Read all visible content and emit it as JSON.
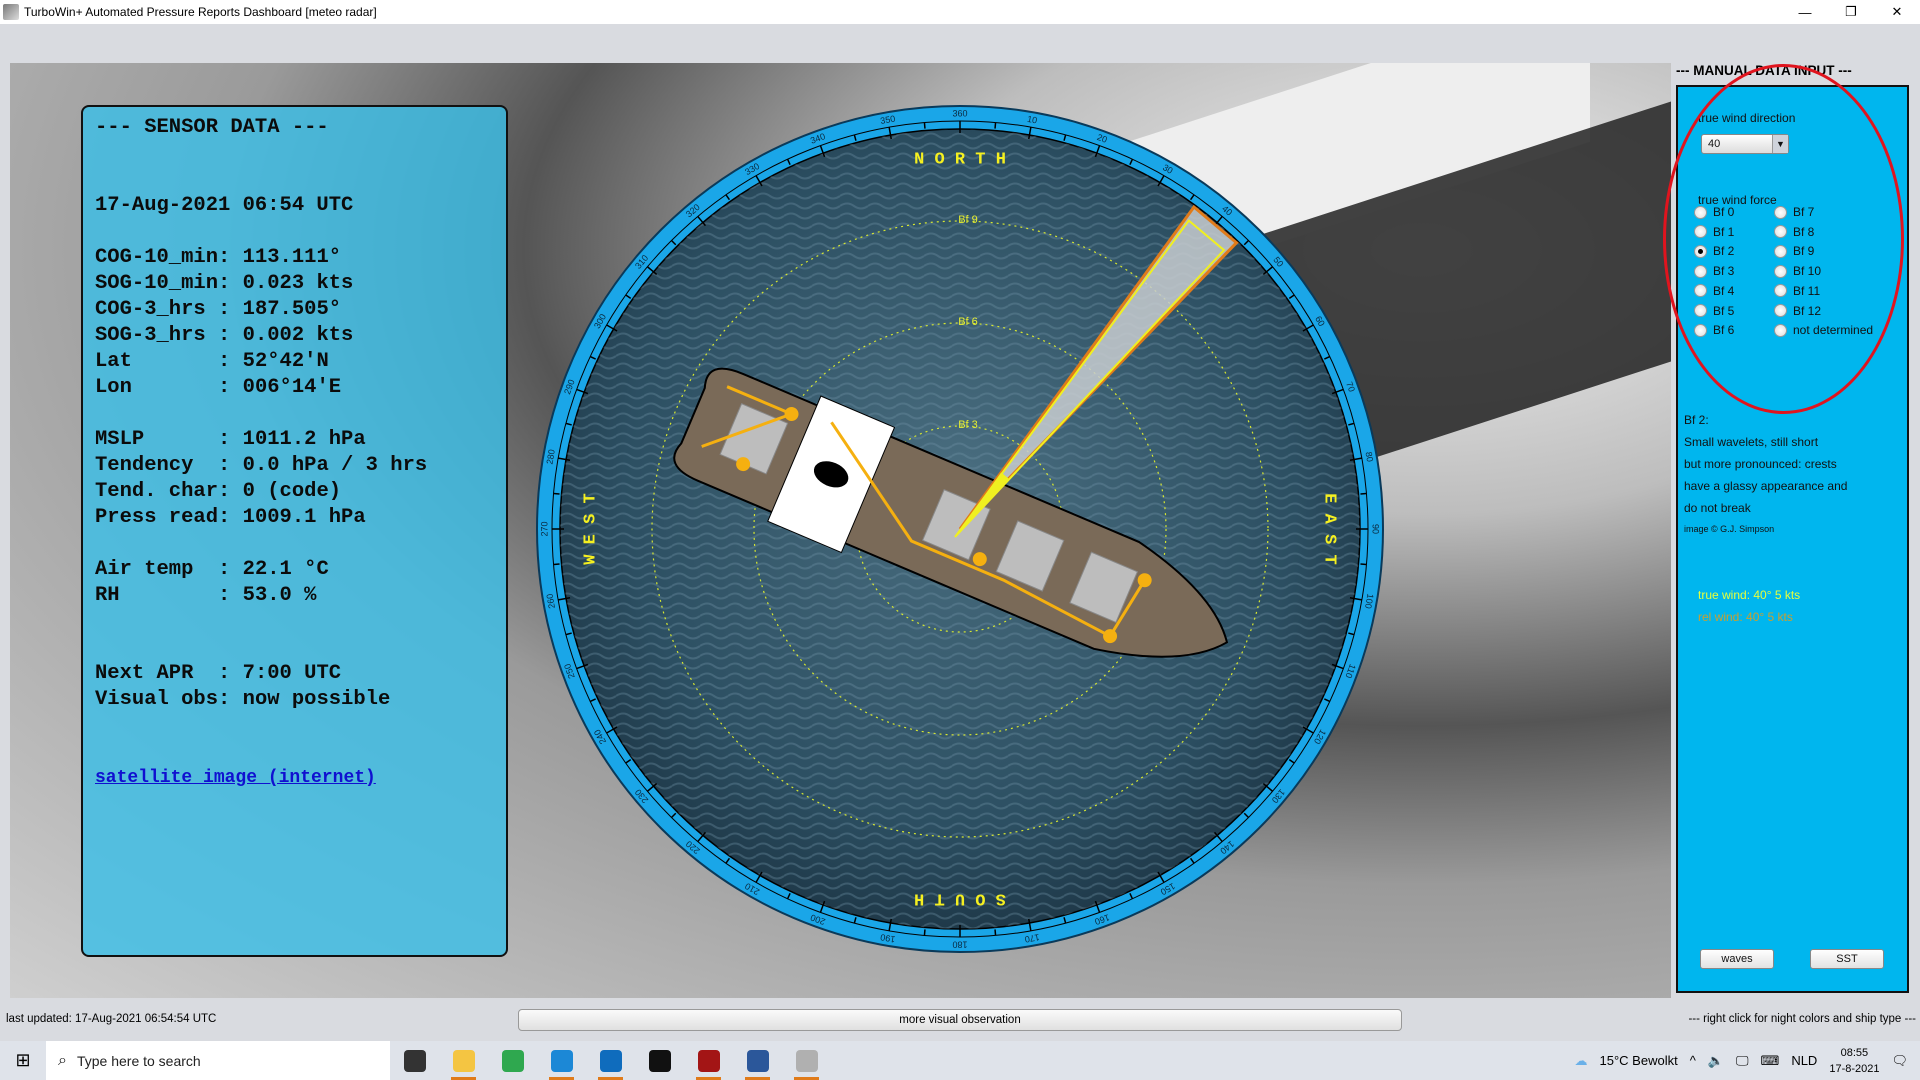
{
  "window": {
    "title": "TurboWin+ Automated Pressure Reports Dashboard [meteo radar]",
    "controls": [
      "—",
      "❐",
      "✕"
    ]
  },
  "sensor": {
    "title": "--- SENSOR DATA ---",
    "datetime": "17-Aug-2021 06:54 UTC",
    "groups": [
      [
        {
          "label": "COG-10_min",
          "value": "113.111°"
        },
        {
          "label": "SOG-10_min",
          "value": "0.023 kts"
        },
        {
          "label": "COG-3_hrs ",
          "value": "187.505°"
        },
        {
          "label": "SOG-3_hrs ",
          "value": "0.002 kts"
        },
        {
          "label": "Lat       ",
          "value": "52°42'N"
        },
        {
          "label": "Lon       ",
          "value": "006°14'E"
        }
      ],
      [
        {
          "label": "MSLP      ",
          "value": "1011.2 hPa"
        },
        {
          "label": "Tendency  ",
          "value": "0.0 hPa / 3 hrs"
        },
        {
          "label": "Tend. char",
          "value": "0 (code)"
        },
        {
          "label": "Press read",
          "value": "1009.1 hPa"
        }
      ],
      [
        {
          "label": "Air temp  ",
          "value": "22.1 °C"
        },
        {
          "label": "RH        ",
          "value": "53.0 %"
        }
      ],
      [
        {
          "label": "Next APR  ",
          "value": "7:00 UTC"
        },
        {
          "label": "Visual obs",
          "value": "now possible"
        }
      ]
    ],
    "link": "satellite image (internet)"
  },
  "compass": {
    "north": "N O R T H",
    "south": "S O U T H",
    "east": "E A S T",
    "west": "W E S T",
    "tick_labels": [
      "360",
      "10",
      "20",
      "30",
      "40",
      "50",
      "60",
      "70",
      "80",
      "90",
      "100",
      "110",
      "120",
      "130",
      "140",
      "150",
      "160",
      "170",
      "180",
      "190",
      "200",
      "210",
      "220",
      "230",
      "240",
      "250",
      "260",
      "270",
      "280",
      "290",
      "300",
      "310",
      "320",
      "330",
      "340",
      "350"
    ],
    "rings": [
      "Bf 3",
      "Bf 6",
      "Bf 9"
    ],
    "true_wind_direction_deg": 40,
    "ship_heading_deg": 113,
    "colors": {
      "ring": "#1aa6e8",
      "labels": "#f5f020",
      "sector_edge": "#e07b1a",
      "ship_hull": "#7a6a58"
    }
  },
  "manual": {
    "title": "--- MANUAL DATA INPUT ---",
    "dir_label": "true wind direction",
    "dir_value": "40",
    "force_label": "true wind force",
    "forces": [
      "Bf 0",
      "Bf 1",
      "Bf 2",
      "Bf 3",
      "Bf 4",
      "Bf 5",
      "Bf 6",
      "Bf 7",
      "Bf 8",
      "Bf 9",
      "Bf 10",
      "Bf 11",
      "Bf 12",
      "not determined"
    ],
    "selected_force": "Bf 2",
    "desc": [
      "Bf 2:",
      "Small wavelets, still short",
      "but more pronounced: crests",
      "have a glassy appearance and",
      "do not break"
    ],
    "credit": "image © G.J. Simpson",
    "true_wind": "true wind: 40° 5 kts",
    "rel_wind": "rel wind: 40° 5 kts",
    "waves_btn": "waves",
    "sst_btn": "SST"
  },
  "status": {
    "last_updated": "last updated:  17-Aug-2021 06:54:54 UTC",
    "more_btn": "more visual observation",
    "hint": "--- right click for night colors and ship type ---"
  },
  "taskbar": {
    "search_placeholder": "Type here to search",
    "weather": "15°C  Bewolkt",
    "lang": "NLD",
    "time": "08:55",
    "date": "17-8-2021",
    "apps": [
      {
        "name": "task-view",
        "color": "#333"
      },
      {
        "name": "file-explorer",
        "color": "#f4c542"
      },
      {
        "name": "chrome",
        "color": "#2fa84f"
      },
      {
        "name": "edge",
        "color": "#1c88d6"
      },
      {
        "name": "outlook",
        "color": "#0f6cbd"
      },
      {
        "name": "terminal",
        "color": "#111"
      },
      {
        "name": "puzzle-app",
        "color": "#a31515"
      },
      {
        "name": "word",
        "color": "#2b579a"
      },
      {
        "name": "java-app",
        "color": "#b0b0b0"
      }
    ]
  }
}
